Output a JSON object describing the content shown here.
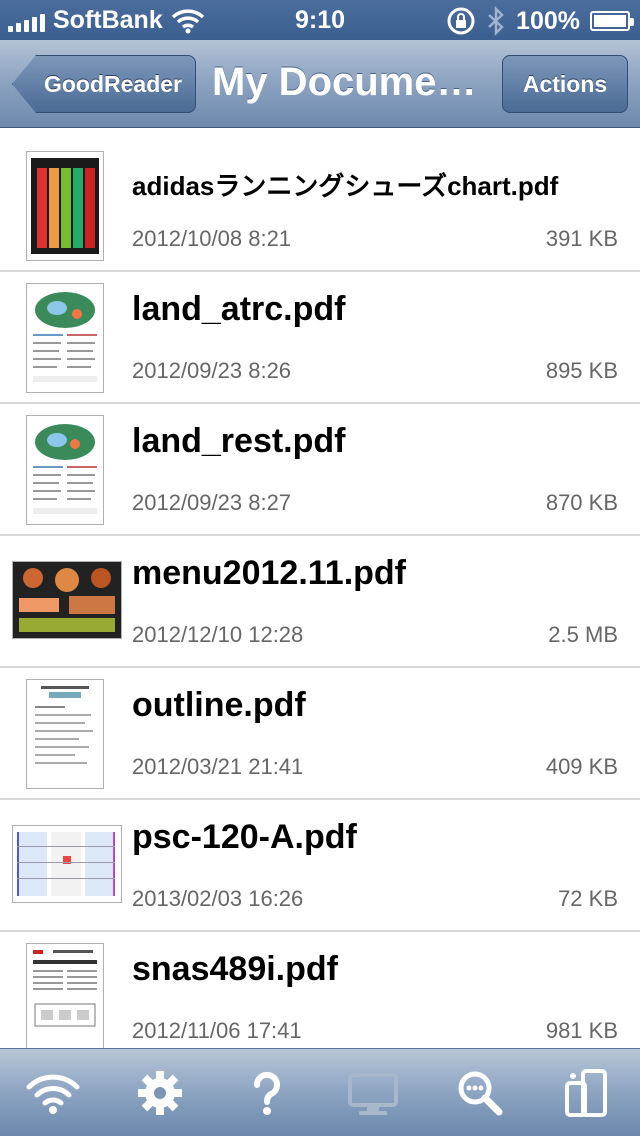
{
  "status": {
    "carrier": "SoftBank",
    "time": "9:10",
    "battery": "100%"
  },
  "nav": {
    "back_label": "GoodReader",
    "title": "My Docume…",
    "actions_label": "Actions"
  },
  "files": [
    {
      "name": "adidasランニングシューズchart.pdf",
      "date": "2012/10/08 8:21",
      "size": "391 KB"
    },
    {
      "name": "land_atrc.pdf",
      "date": "2012/09/23 8:26",
      "size": "895 KB"
    },
    {
      "name": "land_rest.pdf",
      "date": "2012/09/23 8:27",
      "size": "870 KB"
    },
    {
      "name": "menu2012.11.pdf",
      "date": "2012/12/10 12:28",
      "size": "2.5 MB"
    },
    {
      "name": "outline.pdf",
      "date": "2012/03/21 21:41",
      "size": "409 KB"
    },
    {
      "name": "psc-120-A.pdf",
      "date": "2013/02/03 16:26",
      "size": "72 KB"
    },
    {
      "name": "snas489i.pdf",
      "date": "2012/11/06 17:41",
      "size": "981 KB"
    }
  ],
  "toolbar": {
    "icons": [
      "wifi-icon",
      "gear-icon",
      "help-icon",
      "monitor-icon",
      "search-icon",
      "manage-files-icon"
    ]
  }
}
